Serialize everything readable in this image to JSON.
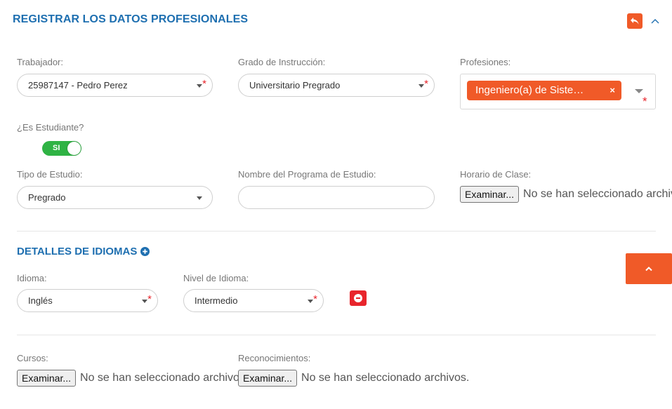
{
  "header": {
    "title": "REGISTRAR LOS DATOS PROFESIONALES"
  },
  "form": {
    "trabajador": {
      "label": "Trabajador:",
      "value": "25987147 - Pedro Perez",
      "required_mark": "*"
    },
    "grado": {
      "label": "Grado de Instrucción:",
      "value": "Universitario Pregrado",
      "required_mark": "*"
    },
    "profesiones": {
      "label": "Profesiones:",
      "tags": [
        "Ingeniero(a) de Siste…"
      ],
      "remove_symbol": "×",
      "required_mark": "*"
    },
    "estudiante": {
      "label": "¿Es Estudiante?",
      "toggle_text": "SI",
      "checked": true
    },
    "tipo_estudio": {
      "label": "Tipo de Estudio:",
      "value": "Pregrado"
    },
    "programa": {
      "label": "Nombre del Programa de Estudio:",
      "value": ""
    },
    "horario": {
      "label": "Horario de Clase:",
      "button": "Examinar...",
      "status": "No se han seleccionado archivos."
    }
  },
  "idiomas": {
    "title": "DETALLES DE IDIOMAS",
    "idioma": {
      "label": "Idioma:",
      "value": "Inglés",
      "required_mark": "*"
    },
    "nivel": {
      "label": "Nivel de Idioma:",
      "value": "Intermedio",
      "required_mark": "*"
    }
  },
  "adjuntos": {
    "cursos": {
      "label": "Cursos:",
      "button": "Examinar...",
      "status": "No se han seleccionado archivos."
    },
    "reconocimientos": {
      "label": "Reconocimientos:",
      "button": "Examinar...",
      "status": "No se han seleccionado archivos."
    }
  },
  "colors": {
    "accent": "#f05a28",
    "title_blue": "#1e6fb0",
    "toggle_green": "#2fb344",
    "danger": "#e8252c"
  },
  "icons": {
    "back": "undo-arrow-icon",
    "collapse": "chevron-up-icon",
    "add": "plus-circle-icon",
    "remove": "minus-circle-icon",
    "scroll_top": "chevron-up-icon"
  }
}
